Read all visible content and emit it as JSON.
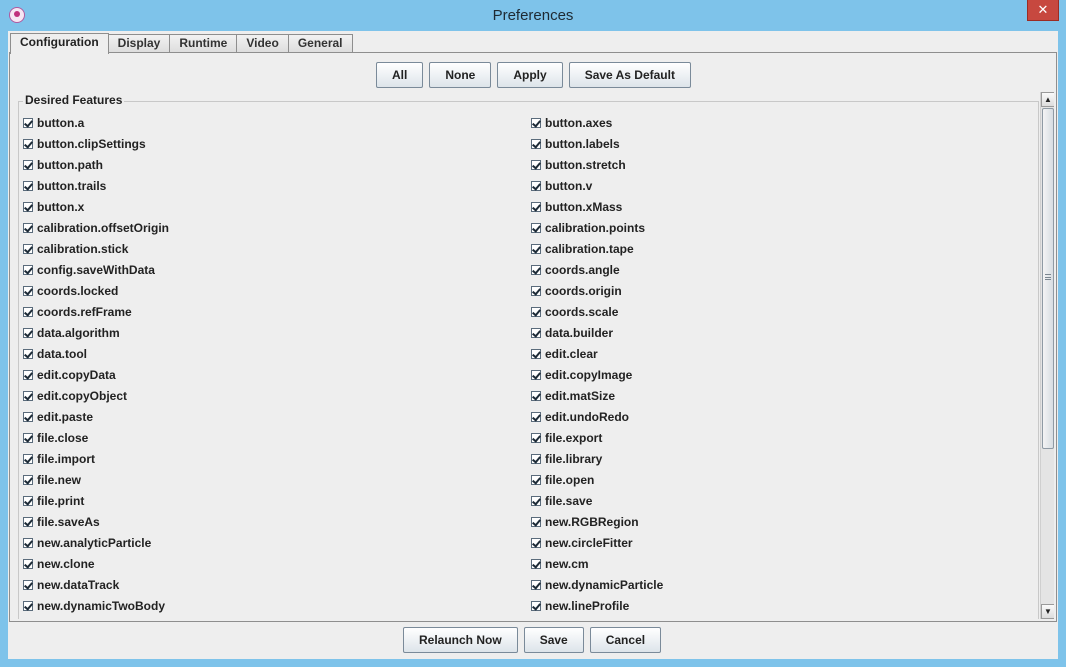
{
  "window": {
    "title": "Preferences",
    "close_glyph": "✕"
  },
  "tabs": [
    {
      "label": "Configuration",
      "active": true
    },
    {
      "label": "Display",
      "active": false
    },
    {
      "label": "Runtime",
      "active": false
    },
    {
      "label": "Video",
      "active": false
    },
    {
      "label": "General",
      "active": false
    }
  ],
  "toolbar": {
    "all_label": "All",
    "none_label": "None",
    "apply_label": "Apply",
    "save_default_label": "Save As Default"
  },
  "features": {
    "title": "Desired Features",
    "left": [
      "button.a",
      "button.clipSettings",
      "button.path",
      "button.trails",
      "button.x",
      "calibration.offsetOrigin",
      "calibration.stick",
      "config.saveWithData",
      "coords.locked",
      "coords.refFrame",
      "data.algorithm",
      "data.tool",
      "edit.copyData",
      "edit.copyObject",
      "edit.paste",
      "file.close",
      "file.import",
      "file.new",
      "file.print",
      "file.saveAs",
      "new.analyticParticle",
      "new.clone",
      "new.dataTrack",
      "new.dynamicTwoBody"
    ],
    "right": [
      "button.axes",
      "button.labels",
      "button.stretch",
      "button.v",
      "button.xMass",
      "calibration.points",
      "calibration.tape",
      "coords.angle",
      "coords.origin",
      "coords.scale",
      "data.builder",
      "edit.clear",
      "edit.copyImage",
      "edit.matSize",
      "edit.undoRedo",
      "file.export",
      "file.library",
      "file.open",
      "file.save",
      "new.RGBRegion",
      "new.circleFitter",
      "new.cm",
      "new.dynamicParticle",
      "new.lineProfile"
    ]
  },
  "scrollbar": {
    "up_glyph": "▲",
    "down_glyph": "▼"
  },
  "footer": {
    "relaunch_label": "Relaunch Now",
    "save_label": "Save",
    "cancel_label": "Cancel"
  }
}
